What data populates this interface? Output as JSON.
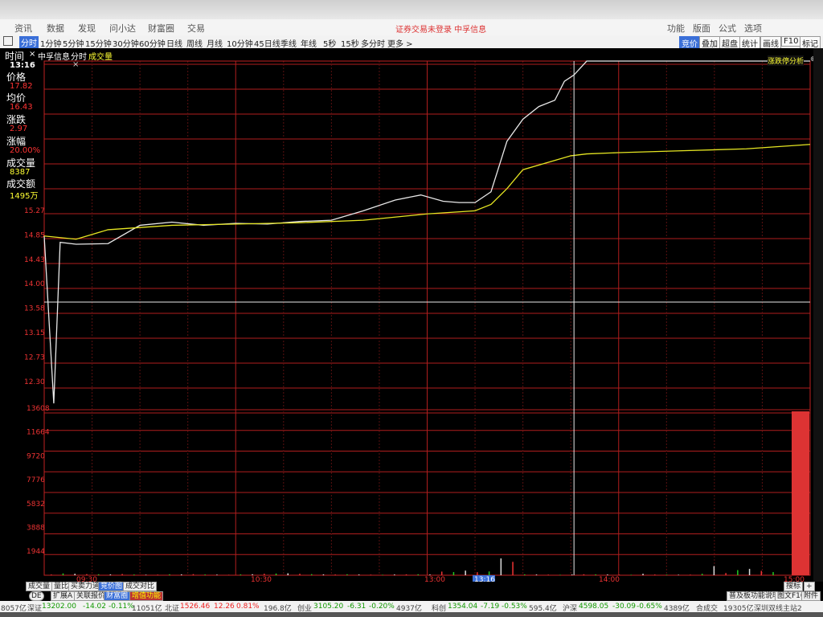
{
  "menu": {
    "items": [
      "资讯",
      "数据",
      "发现",
      "问小达",
      "财富圈",
      "交易"
    ],
    "notice": "证券交易未登录  中孚信息",
    "right_items": [
      "功能",
      "版面",
      "公式",
      "选项"
    ]
  },
  "timeframes": [
    "分时",
    "1分钟",
    "5分钟",
    "15分钟",
    "30分钟",
    "60分钟",
    "日线",
    "周线",
    "月线",
    "10分钟",
    "45日线",
    "季线",
    "年线",
    "5秒",
    "15秒",
    "多分时",
    "更多 >"
  ],
  "right_tools": [
    "竞价",
    "叠加",
    "超盘",
    "统计",
    "画线",
    "F10",
    "标记"
  ],
  "chart_header": {
    "time_label": "时间",
    "close_x": "×",
    "stock": "中孚信息",
    "mode": "分时",
    "volume_label": "成交量",
    "panel_close": "×",
    "limit_btn": "涨跌停分析"
  },
  "info": {
    "time_value": "13:16",
    "price_label": "价格",
    "price_value": "17.82",
    "avg_label": "均价",
    "avg_value": "16.43",
    "change_label": "涨跌",
    "change_value": "2.97",
    "pct_label": "涨幅",
    "pct_value": "20.00%",
    "vol_label": "成交量",
    "vol_value": "8387",
    "amount_label": "成交额",
    "amount_value": "1495万"
  },
  "chart_data": {
    "type": "line",
    "price_ticks": [
      "15.27",
      "14.85",
      "14.43",
      "14.00",
      "13.58",
      "13.15",
      "12.73",
      "12.30"
    ],
    "volume_ticks": [
      "13608",
      "11664",
      "9720",
      "7776",
      "5832",
      "3888",
      "1944"
    ],
    "time_labels": [
      "09:30",
      "10:30",
      "13:00",
      "13:16",
      "14:00",
      "15:00"
    ],
    "ylim": [
      12.3,
      17.82
    ],
    "series": [
      {
        "name": "价格",
        "color": "#e8e8e8",
        "x": [
          0,
          3,
          5,
          10,
          20,
          30,
          40,
          50,
          60,
          70,
          80,
          90,
          100,
          110,
          118,
          125,
          130,
          135,
          140,
          145,
          150,
          155,
          160,
          163,
          166,
          170,
          178,
          240
        ],
        "y": [
          15.05,
          12.4,
          14.95,
          14.92,
          14.93,
          15.22,
          15.27,
          15.22,
          15.25,
          15.24,
          15.28,
          15.3,
          15.45,
          15.62,
          15.7,
          15.6,
          15.58,
          15.58,
          15.75,
          16.55,
          16.9,
          17.1,
          17.2,
          17.5,
          17.6,
          17.82,
          17.82,
          17.82
        ]
      },
      {
        "name": "均价",
        "color": "#e6e622",
        "x": [
          0,
          10,
          20,
          40,
          60,
          80,
          100,
          120,
          135,
          140,
          145,
          150,
          165,
          170,
          180,
          200,
          220,
          240
        ],
        "y": [
          15.05,
          15.0,
          15.15,
          15.22,
          15.24,
          15.26,
          15.3,
          15.4,
          15.45,
          15.55,
          15.8,
          16.1,
          16.32,
          16.35,
          16.37,
          16.4,
          16.43,
          16.5
        ]
      }
    ],
    "volume": [
      60,
      150,
      120,
      90,
      80,
      70,
      100,
      60,
      40,
      50,
      80,
      70,
      90,
      60,
      50,
      40,
      70,
      80,
      120,
      140,
      160,
      120,
      90,
      70,
      60,
      80,
      60,
      50,
      40,
      60,
      70,
      80,
      60,
      300,
      260,
      380,
      250,
      310,
      1380,
      1100,
      70,
      60,
      50,
      40,
      60,
      80,
      70,
      60,
      50,
      40,
      120,
      60,
      50,
      40,
      50,
      120,
      750,
      180,
      420,
      520,
      360,
      260
    ]
  },
  "bottom_tabs": [
    "成交量",
    "量比",
    "买卖力道",
    "竞价图",
    "成交对比"
  ],
  "bottom_tabs2": [
    "DE",
    "扩展A",
    "关联报价",
    "财富圈",
    "增值功能"
  ],
  "bottom_right": [
    "搜标",
    "+"
  ],
  "bottom_right2": [
    "普及板功能说明",
    "图文F10",
    "附件"
  ],
  "status": {
    "sz_label": "深证",
    "sz_value": "13202.00",
    "sz_chg": "-14.02",
    "sz_pct": "-0.11%",
    "sz_amt": "11051亿",
    "bz_label": "北证",
    "bz_value": "1526.46",
    "bz_chg": "12.26",
    "bz_pct": "0.81%",
    "bz_amt": "196.8亿",
    "cy_label": "创业",
    "cy_value": "3105.20",
    "cy_chg": "-6.31",
    "cy_pct": "-0.20%",
    "cy_amt": "4937亿",
    "kc_label": "科创",
    "kc_value": "1354.04",
    "kc_chg": "-7.19",
    "kc_pct": "-0.53%",
    "kc_amt": "595.4亿",
    "hs_label": "沪深",
    "hs_value": "4598.05",
    "hs_chg": "-30.09",
    "hs_pct": "-0.65%",
    "hs_amt": "4389亿",
    "total_label": "合成交",
    "total_value": "19305亿",
    "site": "深圳双线主站2",
    "left_amt": "8057亿"
  }
}
